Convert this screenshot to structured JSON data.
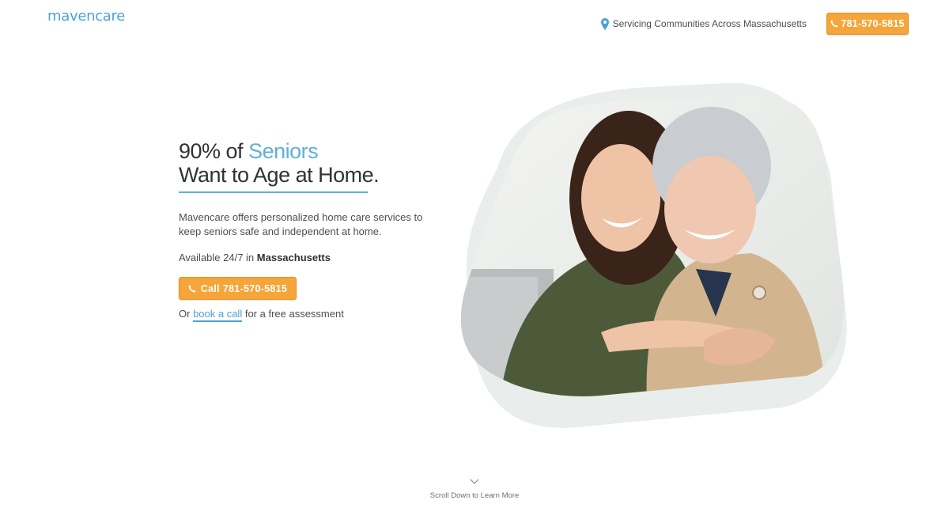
{
  "header": {
    "logo": "mavencare",
    "location_text": "Servicing Communities Across Massachusetts",
    "phone_label": "781-570-5815"
  },
  "hero": {
    "headline_part1": "90% of ",
    "headline_accent": "Seniors",
    "headline_line2": "Want to Age at Home.",
    "description": "Mavencare offers personalized home care services to keep seniors safe and independent at home.",
    "availability_prefix": "Available 24/7 in ",
    "availability_location": "Massachusetts",
    "cta_label": "Call 781-570-5815",
    "secondary_prefix": "Or ",
    "book_link": "book a call",
    "secondary_suffix": " for a free assessment"
  },
  "footer": {
    "scroll_text": "Scroll Down to Learn More"
  },
  "colors": {
    "accent_blue": "#5fb0d8",
    "cta_orange": "#f5a53a",
    "blob_gray": "#e9eeec"
  },
  "icons": [
    "map-pin-icon",
    "phone-icon",
    "chevron-down-icon"
  ]
}
